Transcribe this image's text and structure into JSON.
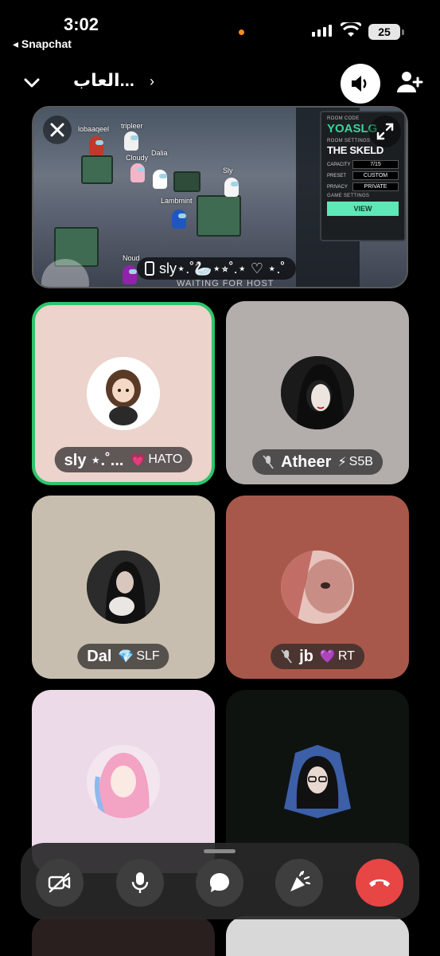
{
  "status_bar": {
    "time": "3:02",
    "back_app": "◂ Snapchat",
    "battery": "25"
  },
  "header": {
    "title": "العاب...",
    "speaker_icon": "speaker-icon",
    "add_friend_icon": "add-friend-icon"
  },
  "game_screen": {
    "room_code_label": "ROOM CODE",
    "room_code": "YOASLG",
    "room_settings_label": "ROOM SETTINGS",
    "map": "THE SKELD",
    "capacity_label": "CAPACITY",
    "capacity": "7/15",
    "preset_label": "PRESET",
    "preset": "CUSTOM",
    "privacy_label": "PRIVACY",
    "privacy": "PRIVATE",
    "game_settings_label": "GAME SETTINGS",
    "view_button": "VIEW",
    "waiting_text": "WAITING FOR HOST",
    "sharer_name": "sly⋆.˚🦢⋆⭒˚.⋆ ♡ ⋆.˚",
    "players": [
      "lobaaqeel",
      "tripleer",
      "Cloudy",
      "Dalia",
      "Lambmint",
      "Sly",
      "Noud"
    ]
  },
  "participants": [
    {
      "name": "sly ⋆.˚...",
      "badge_icon": "💗",
      "badge": "HATO",
      "muted": false,
      "speaking": true,
      "bg": "#ecd3cb"
    },
    {
      "name": "Atheer",
      "badge_icon": "⚡",
      "badge": "S5B",
      "muted": true,
      "speaking": false,
      "bg": "#b3aeab"
    },
    {
      "name": "Dal",
      "badge_icon": "💎",
      "badge": "SLF",
      "muted": false,
      "speaking": false,
      "bg": "#c8beaf"
    },
    {
      "name": "jb",
      "badge_icon": "💜",
      "badge": "RT",
      "muted": true,
      "speaking": false,
      "bg": "#a8584a"
    },
    {
      "name": "",
      "badge": "",
      "bg": "#ecdae9"
    },
    {
      "name": "",
      "badge": "",
      "bg": "#0f1310"
    }
  ],
  "controls": [
    "camera-off-icon",
    "microphone-icon",
    "chat-icon",
    "lens-icon",
    "end-call-icon"
  ]
}
